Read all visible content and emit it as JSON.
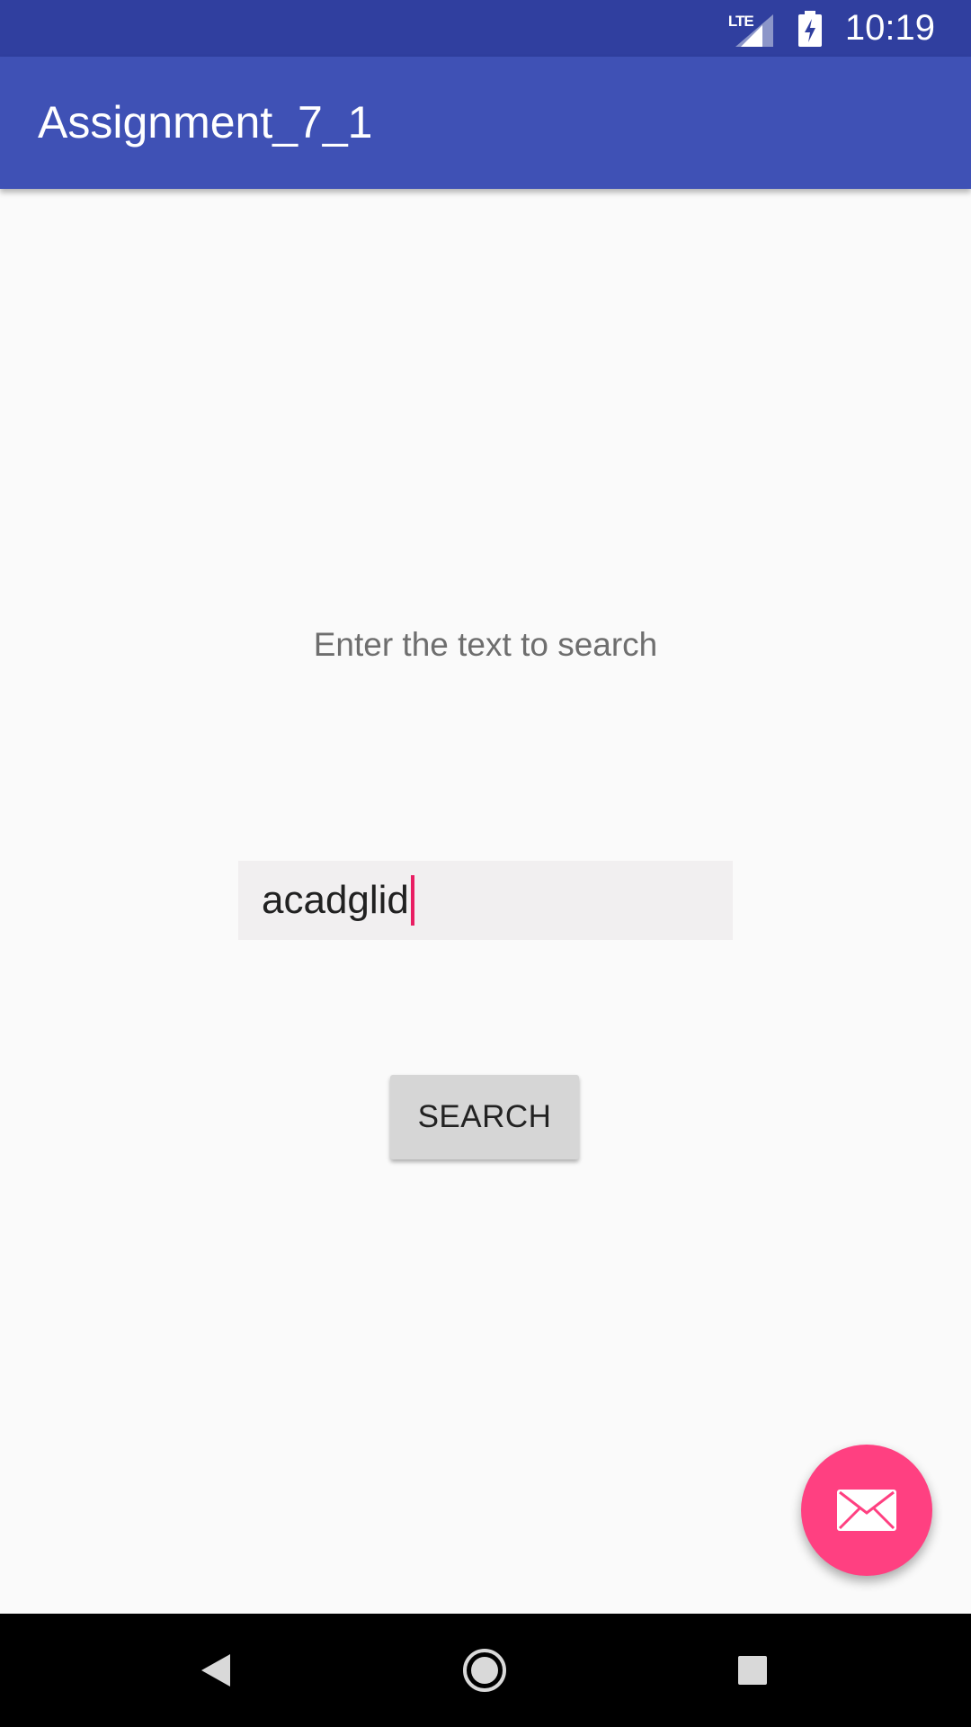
{
  "status_bar": {
    "network_label": "LTE",
    "time": "10:19",
    "icons": [
      "lte-signal-icon",
      "battery-charging-icon"
    ]
  },
  "app_bar": {
    "title": "Assignment_7_1",
    "color": "#3f51b5"
  },
  "content": {
    "prompt_label": "Enter the text to search",
    "search_field": {
      "value": "acadglid"
    },
    "search_button_label": "SEARCH"
  },
  "fab": {
    "icon": "email-icon",
    "color": "#ff4081"
  },
  "nav_bar": {
    "buttons": [
      "back-icon",
      "home-icon",
      "recents-icon"
    ]
  },
  "colors": {
    "status_bar": "#303f9f",
    "accent": "#ff4081",
    "cursor": "#e91e63"
  }
}
